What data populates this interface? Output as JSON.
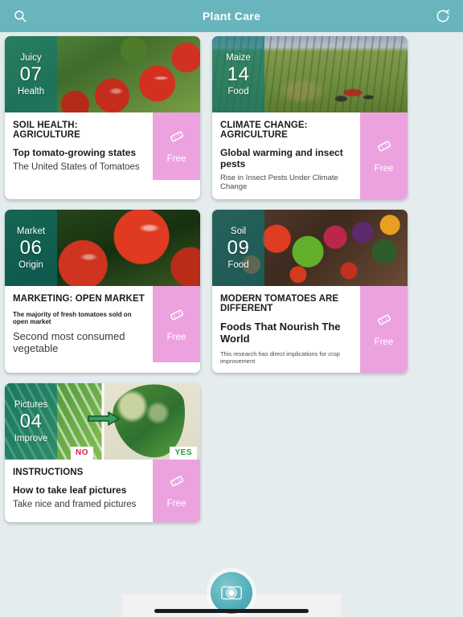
{
  "header": {
    "title": "Plant Care",
    "search_icon": "search-icon",
    "refresh_icon": "refresh-icon"
  },
  "cards": [
    {
      "badge_top": "Juicy",
      "badge_number": "07",
      "badge_bottom": "Health",
      "kicker": "SOIL HEALTH: AGRICULTURE",
      "line2": "Top tomato-growing states",
      "line3": "The United States of Tomatoes",
      "price_label": "Free",
      "ticket_icon": "ticket-icon",
      "image": "tomatoes-on-vine-photo"
    },
    {
      "badge_top": "Maize",
      "badge_number": "14",
      "badge_bottom": "Food",
      "kicker": "CLIMATE CHANGE: AGRICULTURE",
      "line2": "Global warming and insect pests",
      "line3": "Rise in Insect Pests Under Climate Change",
      "price_label": "Free",
      "ticket_icon": "ticket-icon",
      "image": "tractor-in-field-photo"
    },
    {
      "badge_top": "Market",
      "badge_number": "06",
      "badge_bottom": "Origin",
      "kicker": "MARKETING: OPEN MARKET",
      "line2": "The majority of fresh tomatoes sold on open market",
      "line3": "Second most consumed vegetable",
      "price_label": "Free",
      "ticket_icon": "ticket-icon",
      "image": "tomato-closeup-photo"
    },
    {
      "badge_top": "Soil",
      "badge_number": "09",
      "badge_bottom": "Food",
      "kicker": "MODERN TOMATOES ARE DIFFERENT",
      "line2": "Foods That Nourish The World",
      "line3": "This research has direct implications for crop improvement",
      "price_label": "Free",
      "ticket_icon": "ticket-icon",
      "image": "heirloom-tomato-market-photo"
    },
    {
      "badge_top": "Pictures",
      "badge_number": "04",
      "badge_bottom": "Improve",
      "kicker": "INSTRUCTIONS",
      "line2": "How to take leaf pictures",
      "line3": "Take nice and framed pictures",
      "price_label": "Free",
      "ticket_icon": "ticket-icon",
      "image": "leaf-photo-comparison",
      "tag_no": "NO",
      "tag_yes": "YES"
    }
  ],
  "bottom": {
    "camera_button_icon": "camera-icon"
  },
  "colors": {
    "header_teal": "#69b5bd",
    "page_background": "#e5ecee",
    "free_pink": "#eda2e0",
    "badge_overlay": "#0a7676",
    "fab_teal": "#4fafb9"
  }
}
